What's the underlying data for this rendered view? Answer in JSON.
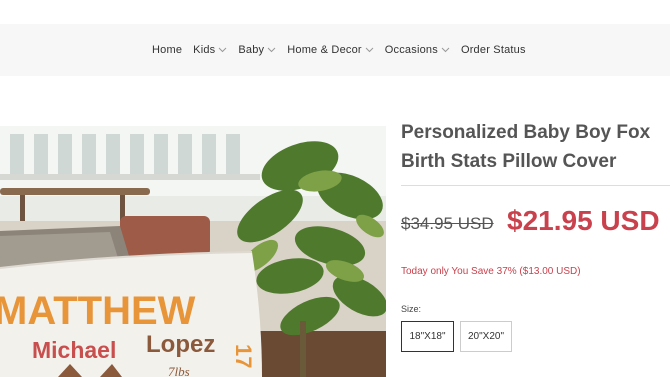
{
  "nav": {
    "items": [
      {
        "label": "Home",
        "dropdown": false
      },
      {
        "label": "Kids",
        "dropdown": true
      },
      {
        "label": "Baby",
        "dropdown": true
      },
      {
        "label": "Home & Decor",
        "dropdown": true
      },
      {
        "label": "Occasions",
        "dropdown": true
      },
      {
        "label": "Order Status",
        "dropdown": false
      }
    ]
  },
  "product": {
    "title": "Personalized Baby Boy Fox Birth Stats Pillow Cover",
    "compare_price": "$34.95 USD",
    "price": "$21.95 USD",
    "savings": "Today only You Save 37% ($13.00 USD)",
    "size_label": "Size:",
    "sizes": [
      "18\"X18\"",
      "20\"X20\""
    ],
    "selected_size": "18\"X18\""
  },
  "image": {
    "line1": "MATTHEW",
    "line2_a": "Michael",
    "line2_b": "Lopez",
    "weight": "7lbs",
    "side_number": "17"
  },
  "colors": {
    "sale": "#c9414c",
    "name_orange": "#e8953a",
    "name_red": "#c94e4e"
  }
}
